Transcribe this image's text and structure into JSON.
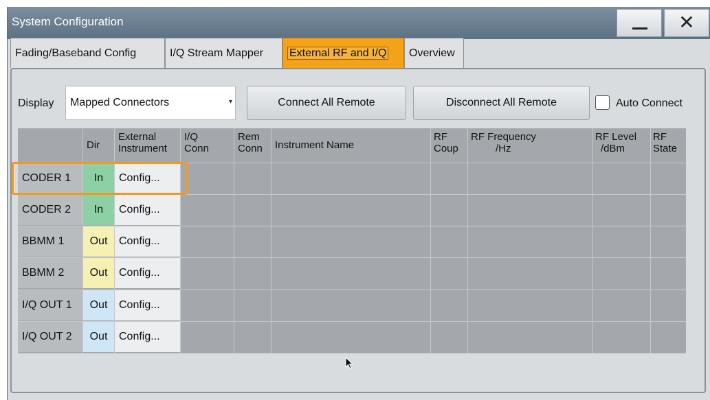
{
  "window": {
    "title": "System Configuration",
    "minimize_label": "minimize",
    "close_label": "✕"
  },
  "tabs": [
    {
      "label": "Fading/Baseband Config"
    },
    {
      "label": "I/Q Stream Mapper"
    },
    {
      "label": "External RF and I/Q"
    },
    {
      "label": "Overview"
    }
  ],
  "toolbar": {
    "display_label": "Display",
    "display_value": "Mapped Connectors",
    "connect_all": "Connect All Remote",
    "disconnect_all": "Disconnect All Remote",
    "auto_connect": "Auto Connect"
  },
  "table": {
    "headers": {
      "dir": "Dir",
      "ext_1": "External",
      "ext_2": "Instrument",
      "iq_1": "I/Q",
      "iq_2": "Conn",
      "rem_1": "Rem",
      "rem_2": "Conn",
      "name": "Instrument Name",
      "rf_1": "RF",
      "rf_2": "Coup",
      "freq_1": "RF Frequency",
      "freq_2": "/Hz",
      "level_1": "RF Level",
      "level_2": "/dBm",
      "state_1": "RF",
      "state_2": "State"
    },
    "rows": [
      {
        "name": "CODER 1",
        "dir": "In",
        "config": "Config..."
      },
      {
        "name": "CODER 2",
        "dir": "In",
        "config": "Config..."
      },
      {
        "name": "BBMM 1",
        "dir": "Out",
        "config": "Config..."
      },
      {
        "name": "BBMM 2",
        "dir": "Out",
        "config": "Config..."
      },
      {
        "name": "I/Q OUT 1",
        "dir": "Out",
        "config": "Config..."
      },
      {
        "name": "I/Q OUT 2",
        "dir": "Out",
        "config": "Config..."
      }
    ]
  },
  "colors": {
    "accent": "#f4a21a",
    "highlight": "#f39a1c",
    "dir_in": "#8ed0a6",
    "dir_out": "#f5f0b4",
    "dir_iq_out": "#cfe6f6"
  }
}
